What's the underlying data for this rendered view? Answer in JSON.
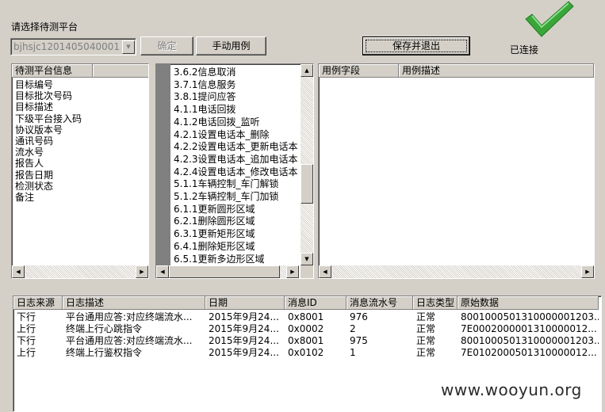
{
  "header": {
    "select_platform_label": "请选择待测平台",
    "platform_select_value": "bjhsjc1201405040001",
    "confirm_label": "确定",
    "manual_case_label": "手动用例",
    "save_exit_label": "保存并退出",
    "connected_label": "已连接"
  },
  "platform_info": {
    "column": "待测平台信息",
    "items": [
      "目标编号",
      "目标批次号码",
      "目标描述",
      "下级平台接入码",
      "协议版本号",
      "通讯号码",
      "流水号",
      "报告人",
      "报告日期",
      "检测状态",
      "备注"
    ]
  },
  "case_list": {
    "items": [
      "3.6.2信息取消",
      "3.7.1信息服务",
      "3.8.1提问应答",
      "4.1.1电话回拨",
      "4.1.2电话回拨_监听",
      "4.2.1设置电话本_删除",
      "4.2.2设置电话本_更新电话本",
      "4.2.3设置电话本_追加电话本",
      "4.2.4设置电话本_修改电话本",
      "5.1.1车辆控制_车门解锁",
      "5.1.2车辆控制_车门加锁",
      "6.1.1更新圆形区域",
      "6.2.1删除圆形区域",
      "6.3.1更新矩形区域",
      "6.4.1删除矩形区域",
      "6.5.1更新多边形区域"
    ]
  },
  "case_fields": {
    "columns": [
      "用例字段",
      "用例描述"
    ]
  },
  "log_table": {
    "columns": [
      "日志来源",
      "日志描述",
      "日期",
      "消息ID",
      "消息流水号",
      "日志类型",
      "原始数据"
    ],
    "rows": [
      [
        "下行",
        "平台通用应答:对应终端流水...",
        "2015年9月24...",
        "0x8001",
        "976",
        "正常",
        "8001000501310000001203..."
      ],
      [
        "上行",
        "终端上行心跳指令",
        "2015年9月24...",
        "0x0002",
        "2",
        "正常",
        "7E0002000001310000012..."
      ],
      [
        "下行",
        "平台通用应答:对应终端流水...",
        "2015年9月24...",
        "0x8001",
        "975",
        "正常",
        "8001000501310000001203..."
      ],
      [
        "上行",
        "终端上行鉴权指令",
        "2015年9月24...",
        "0x0102",
        "1",
        "正常",
        "7E0102000501310000012..."
      ]
    ]
  },
  "watermark": "www.wooyun.org",
  "colors": {
    "check_green": "#3aa63a",
    "bg": "#d4d0c8"
  }
}
